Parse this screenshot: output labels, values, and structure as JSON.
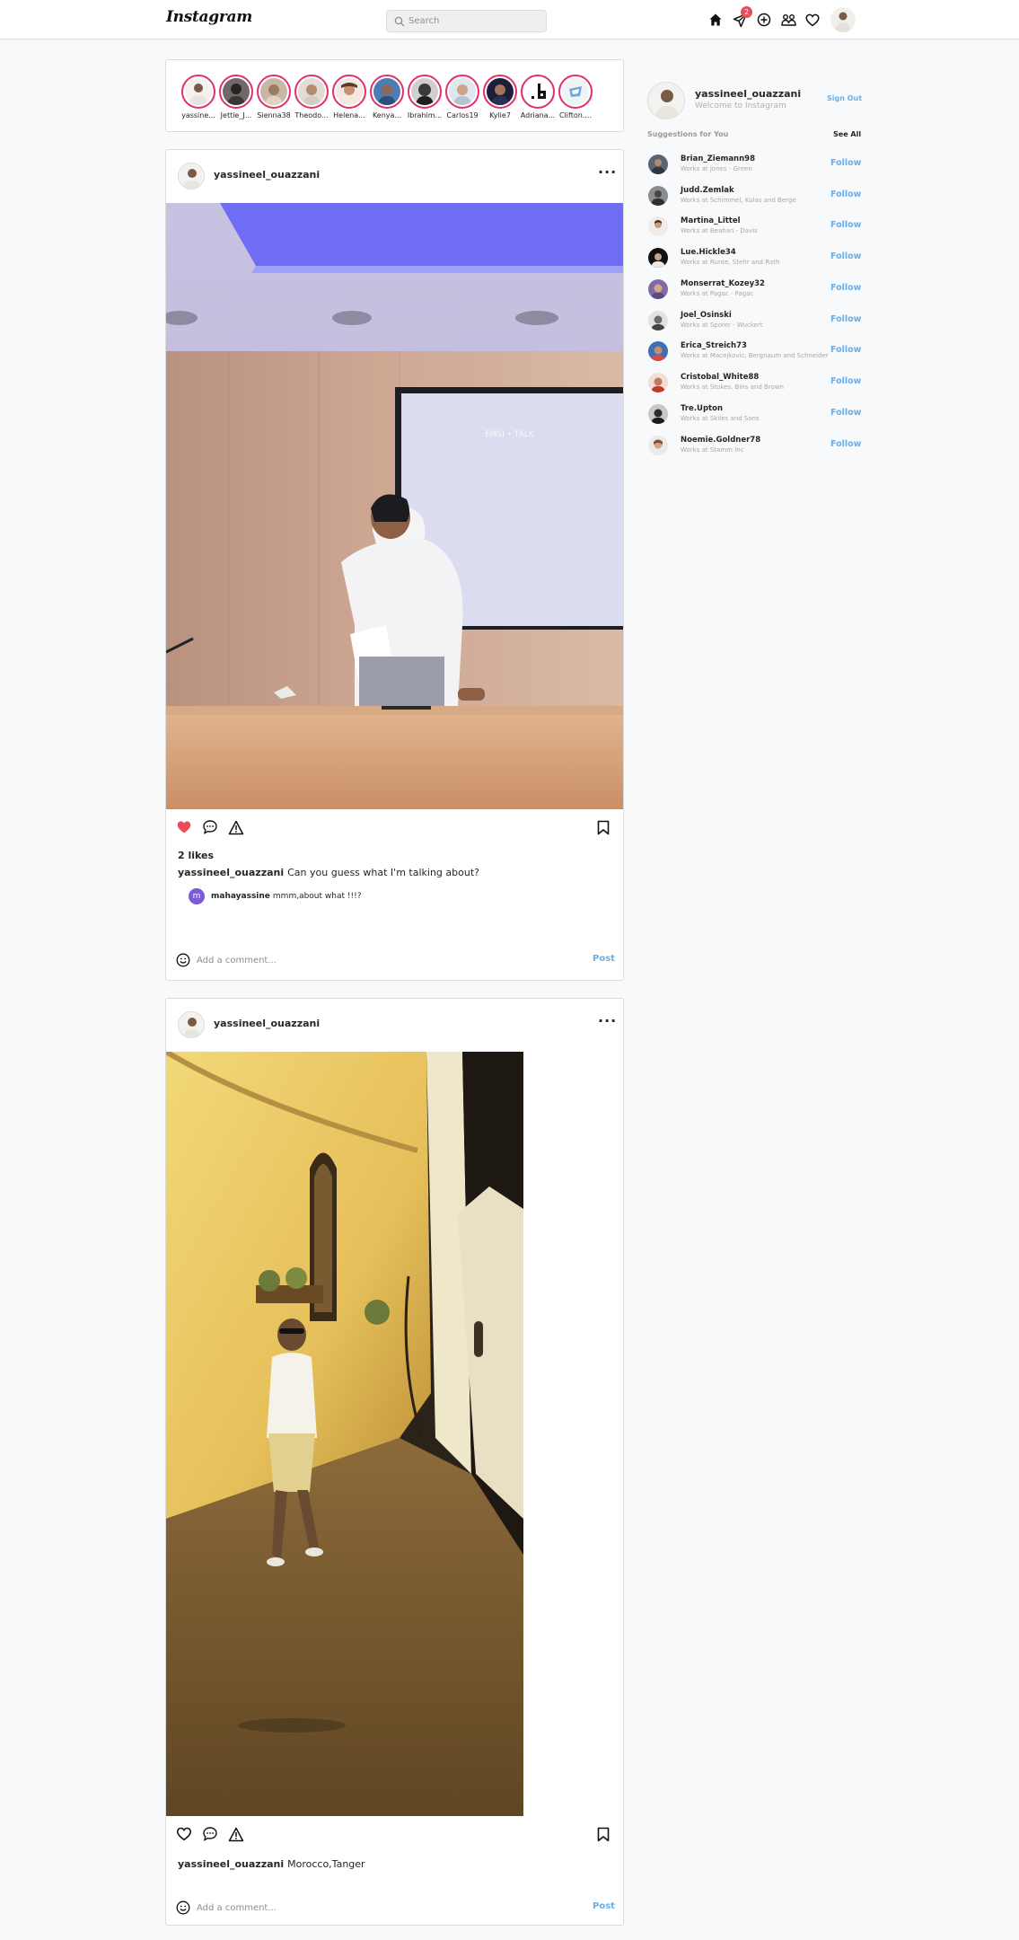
{
  "header": {
    "logo": "Instagram",
    "search_placeholder": "Search",
    "messages_badge": "2",
    "icons": [
      "home-icon",
      "direct-messages-icon",
      "new-post-icon",
      "explore-icon",
      "activity-heart-icon"
    ]
  },
  "stories": [
    {
      "name": "yassine..."
    },
    {
      "name": "Jettie_J..."
    },
    {
      "name": "Sienna38"
    },
    {
      "name": "Theodo..."
    },
    {
      "name": "Helena..."
    },
    {
      "name": "Kenya..."
    },
    {
      "name": "Ibrahim..."
    },
    {
      "name": "Carlos19"
    },
    {
      "name": "Kylie7"
    },
    {
      "name": "Adriana..."
    },
    {
      "name": "Clifton...."
    }
  ],
  "posts": [
    {
      "username": "yassineel_ouazzani",
      "liked": true,
      "likes": "2 likes",
      "caption_user": "yassineel_ouazzani",
      "caption_text": "Can you guess what I'm talking about?",
      "comment": {
        "avatar_letter": "m",
        "user": "mahayassine",
        "text": "mmm,about what !!!?"
      },
      "add_comment_placeholder": "Add a comment...",
      "post_label": "Post"
    },
    {
      "username": "yassineel_ouazzani",
      "liked": false,
      "caption_user": "yassineel_ouazzani",
      "caption_text": "Morocco,Tanger",
      "add_comment_placeholder": "Add a comment...",
      "post_label": "Post"
    }
  ],
  "sidebar": {
    "username": "yassineel_ouazzani",
    "subtitle": "Welcome to Instagram",
    "sign_out": "Sign Out",
    "suggestions_title": "Suggestions for You",
    "see_all": "See All",
    "follow_label": "Follow",
    "suggestions": [
      {
        "name": "Brian_Ziemann98",
        "sub": "Works at Jones - Green"
      },
      {
        "name": "Judd.Zemlak",
        "sub": "Works at Schimmel, Kulas and Berge"
      },
      {
        "name": "Martina_Littel",
        "sub": "Works at Beahan - Davis"
      },
      {
        "name": "Lue.Hickle34",
        "sub": "Works at Runte, Stehr and Rath"
      },
      {
        "name": "Monserrat_Kozey32",
        "sub": "Works at Pagac - Pagac"
      },
      {
        "name": "Joel_Osinski",
        "sub": "Works at Sporer - Wuckert"
      },
      {
        "name": "Erica_Streich73",
        "sub": "Works at Macejkovic, Bergnaum and Schneider"
      },
      {
        "name": "Cristobal_White88",
        "sub": "Works at Stokes, Bins and Brown"
      },
      {
        "name": "Tre.Upton",
        "sub": "Works at Skiles and Sons"
      },
      {
        "name": "Noemie.Goldner78",
        "sub": "Works at Stamm Inc"
      }
    ]
  },
  "colors": {
    "accent_blue": "#6aaee8",
    "like_red": "#ed4956",
    "story_ring": "#e1306c",
    "border": "#dbdbdb",
    "background": "#f8f9fb"
  }
}
